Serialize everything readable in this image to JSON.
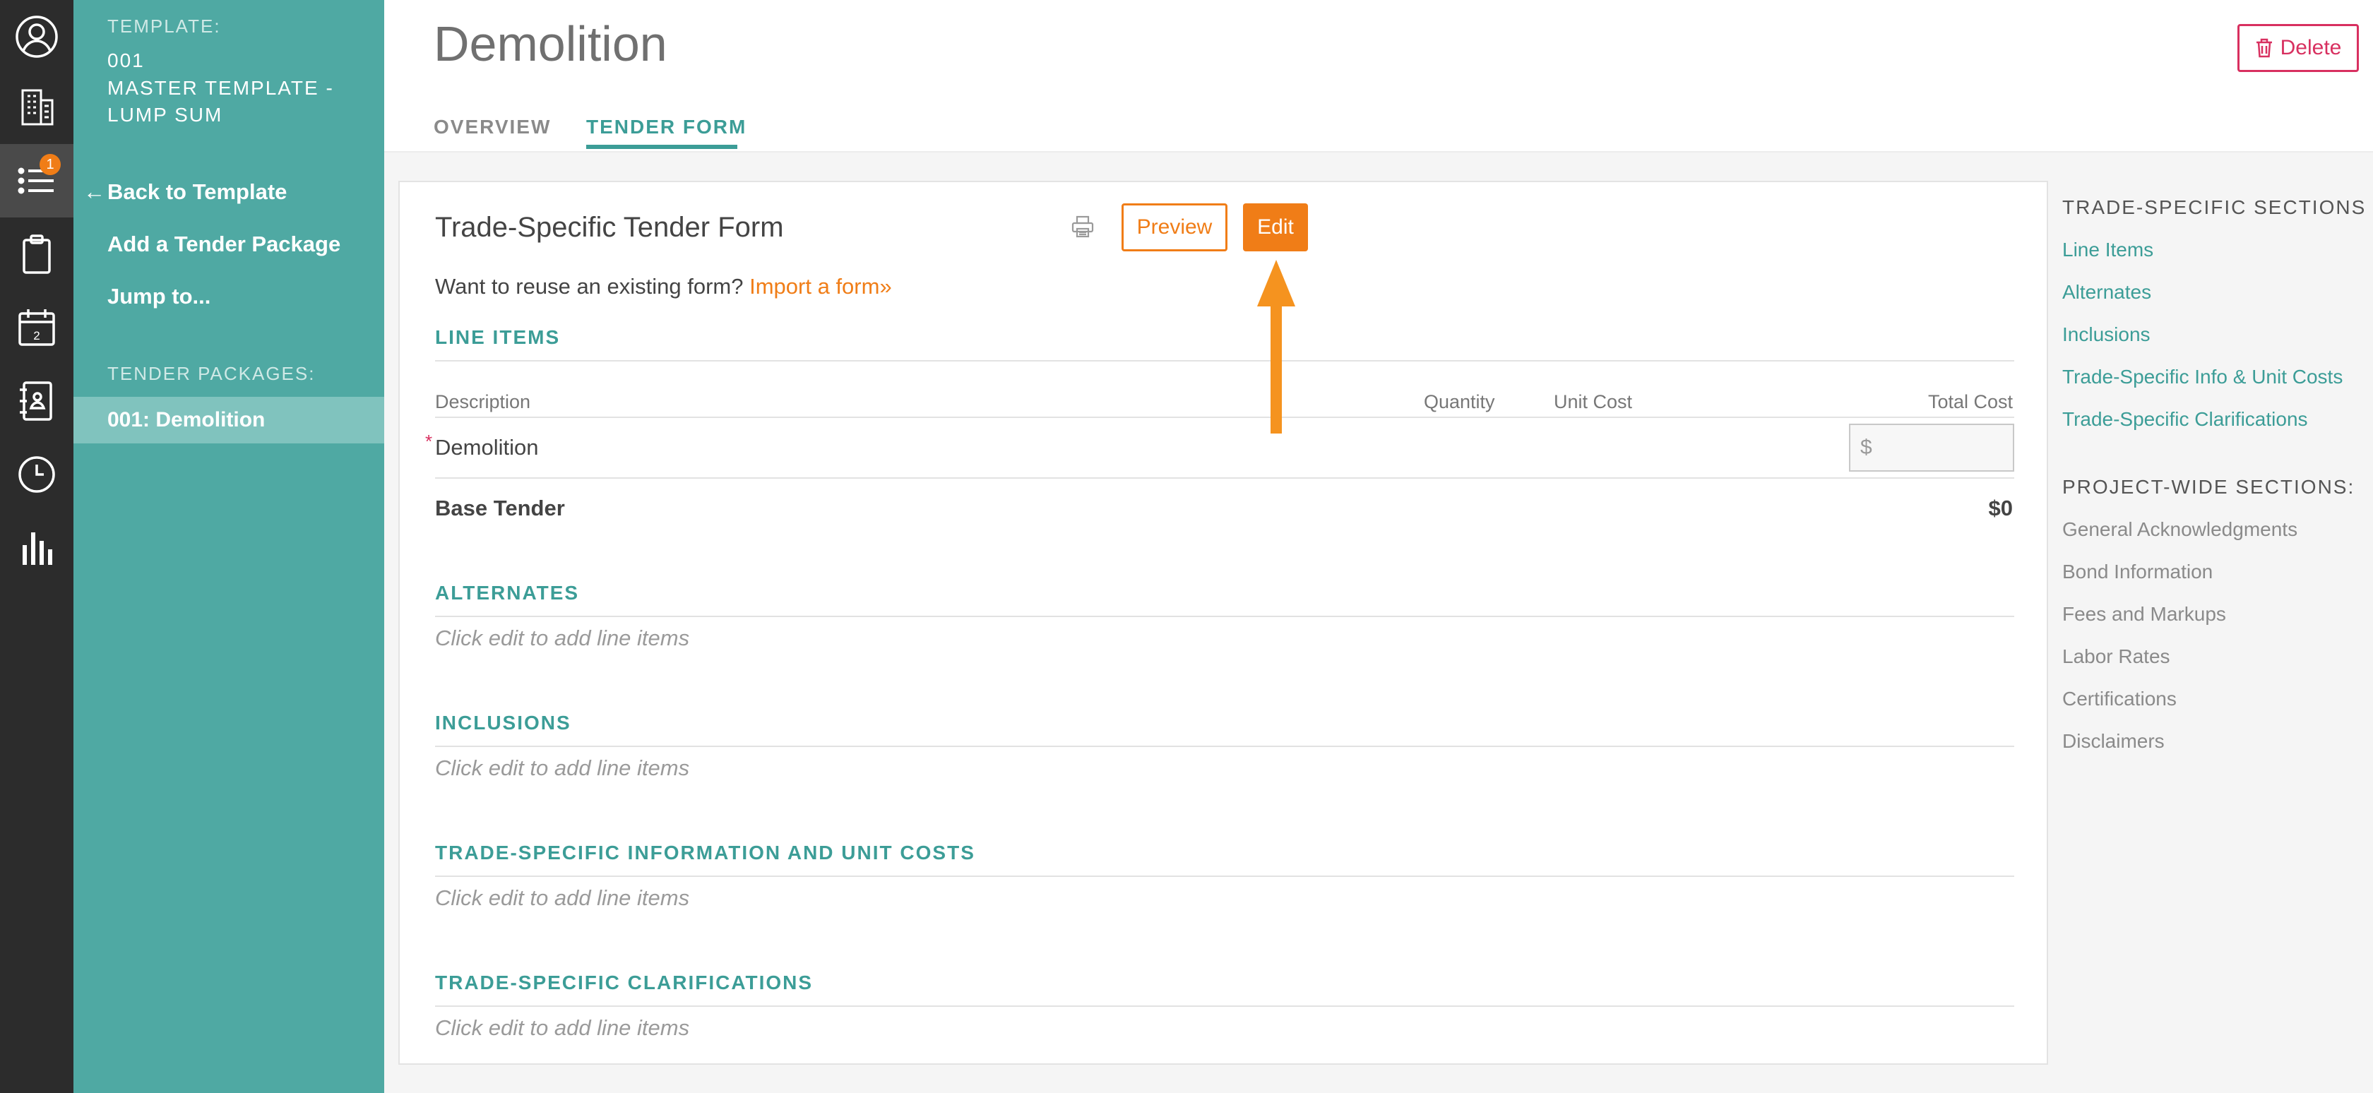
{
  "rail": {
    "badge": "1",
    "icons": [
      "user-avatar-icon",
      "building-icon",
      "list-icon",
      "clipboard-icon",
      "calendar-icon",
      "address-book-icon",
      "clock-icon",
      "bar-chart-icon"
    ],
    "calendar_day": "2"
  },
  "panel": {
    "template_label": "TEMPLATE:",
    "template_number": "001",
    "template_name": "MASTER TEMPLATE - LUMP SUM",
    "back_arrow": "←",
    "back_label": "Back to Template",
    "add_package": "Add a Tender Package",
    "jump_to": "Jump to...",
    "packages_label": "TENDER PACKAGES:",
    "selected_package": "001: Demolition"
  },
  "header": {
    "title": "Demolition",
    "tabs": [
      {
        "label": "OVERVIEW",
        "active": false
      },
      {
        "label": "TENDER FORM",
        "active": true
      }
    ],
    "delete_label": "Delete"
  },
  "form": {
    "title": "Trade-Specific Tender Form",
    "preview_label": "Preview",
    "edit_label": "Edit",
    "reuse_text": "Want to reuse an existing form?",
    "import_link": "Import a form»",
    "line_items": {
      "heading": "LINE ITEMS",
      "columns": [
        "Description",
        "Quantity",
        "Unit Cost",
        "Total Cost"
      ],
      "rows": [
        {
          "required": "*",
          "description": "Demolition",
          "currency_placeholder": "$"
        }
      ],
      "base_label": "Base Tender",
      "base_value": "$0"
    },
    "sections": [
      {
        "heading": "ALTERNATES",
        "empty": "Click edit to add line items"
      },
      {
        "heading": "INCLUSIONS",
        "empty": "Click edit to add line items"
      },
      {
        "heading": "TRADE-SPECIFIC INFORMATION AND UNIT COSTS",
        "empty": "Click edit to add line items"
      },
      {
        "heading": "TRADE-SPECIFIC CLARIFICATIONS",
        "empty": "Click edit to add line items"
      }
    ]
  },
  "sidebar": {
    "trade_heading": "TRADE-SPECIFIC SECTIONS",
    "trade_links": [
      "Line Items",
      "Alternates",
      "Inclusions",
      "Trade-Specific Info & Unit Costs",
      "Trade-Specific Clarifications"
    ],
    "project_heading": "PROJECT-WIDE SECTIONS:",
    "project_links": [
      "General Acknowledgments",
      "Bond Information",
      "Fees and Markups",
      "Labor Rates",
      "Certifications",
      "Disclaimers"
    ]
  },
  "colors": {
    "teal": "#4fa9a3",
    "accent_teal": "#3c9d97",
    "orange": "#f07d17",
    "delete_red": "#d83060",
    "rail": "#2c2c2c"
  }
}
